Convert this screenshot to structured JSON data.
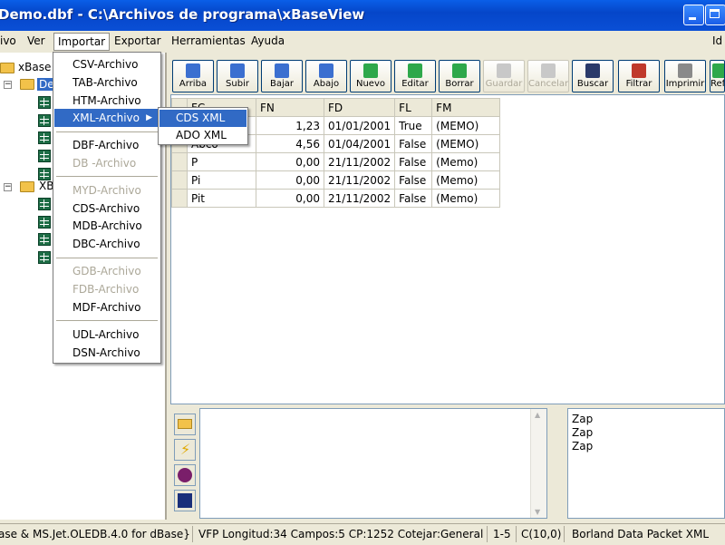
{
  "window": {
    "title": "Demo.dbf - C:\\Archivos de programa\\xBaseView"
  },
  "menubar": {
    "items": [
      "ivo",
      "Ver",
      "Importar",
      "Exportar",
      "Herramientas",
      "Ayuda"
    ],
    "right_label": "Id"
  },
  "import_menu": {
    "items": [
      "CSV-Archivo",
      "TAB-Archivo",
      "HTM-Archivo",
      "XML-Archivo",
      "DBF-Archivo",
      "DB -Archivo",
      "MYD-Archivo",
      "CDS-Archivo",
      "MDB-Archivo",
      "DBC-Archivo",
      "GDB-Archivo",
      "FDB-Archivo",
      "MDF-Archivo",
      "UDL-Archivo",
      "DSN-Archivo"
    ],
    "disabled": [
      "DB -Archivo",
      "MYD-Archivo",
      "GDB-Archivo",
      "FDB-Archivo"
    ]
  },
  "xml_submenu": {
    "items": [
      "CDS XML",
      "ADO XML"
    ]
  },
  "tree": {
    "root_label": "xBase",
    "db1_label": "De",
    "db2_label": "XB"
  },
  "toolbar": {
    "buttons": [
      "Arriba",
      "Subir",
      "Bajar",
      "Abajo",
      "Nuevo",
      "Editar",
      "Borrar",
      "Guardar",
      "Cancelar",
      "Buscar",
      "Filtrar",
      "Imprimir",
      "Ref"
    ],
    "disabled": [
      "Guardar",
      "Cancelar"
    ]
  },
  "grid": {
    "columns": [
      "FC",
      "FN",
      "FD",
      "FL",
      "FM"
    ],
    "rows": [
      {
        "fc": "",
        "fn": "1,23",
        "fd": "01/01/2001",
        "fl": "True",
        "fm": "(MEMO)"
      },
      {
        "fc": "Abco",
        "fn": "4,56",
        "fd": "01/04/2001",
        "fl": "False",
        "fm": "(MEMO)"
      },
      {
        "fc": "P",
        "fn": "0,00",
        "fd": "21/11/2002",
        "fl": "False",
        "fm": "(Memo)"
      },
      {
        "fc": "Pi",
        "fn": "0,00",
        "fd": "21/11/2002",
        "fl": "False",
        "fm": "(Memo)"
      },
      {
        "fc": "Pit",
        "fn": "0,00",
        "fd": "21/11/2002",
        "fl": "False",
        "fm": "(Memo)"
      }
    ]
  },
  "log": {
    "lines": [
      "Zap",
      "Zap",
      "Zap"
    ]
  },
  "statusbar": {
    "driver": "ase & MS.Jet.OLEDB.4.0 for dBase}",
    "info": "VFP  Longitud:34  Campos:5  CP:1252  Cotejar:General",
    "range": "1-5",
    "field_type": "C(10,0)",
    "format": "Borland Data Packet XML"
  },
  "colors": {
    "titlebar": "#0a4fd6",
    "selection": "#316ac5",
    "face": "#ece9d8"
  }
}
